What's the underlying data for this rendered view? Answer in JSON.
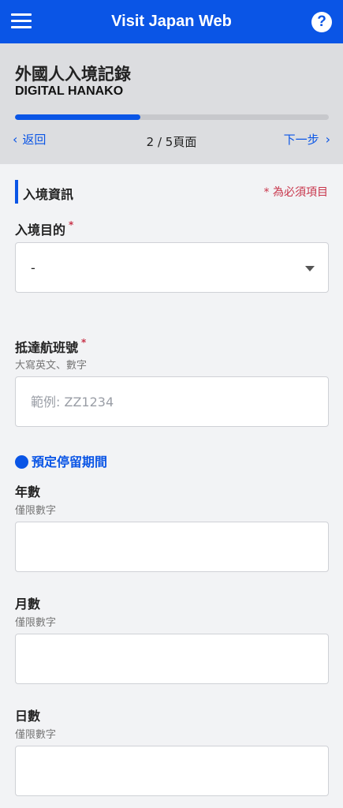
{
  "app": {
    "title": "Visit Japan Web"
  },
  "header": {
    "page_title": "外國人入境記錄",
    "person_name": "DIGITAL HANAKO",
    "progress_fraction": 0.4,
    "back_label": "返回",
    "page_counter": "2 / 5頁面",
    "next_label": "下一步"
  },
  "section": {
    "title": "入境資訊",
    "required_note": "* 為必須項目"
  },
  "purpose": {
    "label": "入境目的",
    "required_mark": "*",
    "selected": "-"
  },
  "flight": {
    "label": "抵達航班號",
    "required_mark": "*",
    "hint": "大寫英文、數字",
    "placeholder": "範例: ZZ1234"
  },
  "stay": {
    "title": "預定停留期間",
    "years": {
      "label": "年數",
      "hint": "僅限數字",
      "value": ""
    },
    "months": {
      "label": "月數",
      "hint": "僅限數字",
      "value": ""
    },
    "days": {
      "label": "日數",
      "hint": "僅限數字",
      "value": ""
    }
  },
  "colors": {
    "brand": "#0a55e6",
    "required": "#c8344a",
    "header_band": "#dcdde0",
    "page_bg": "#f2f3f5"
  },
  "icons": {
    "menu": "hamburger-icon",
    "help": "help-icon",
    "back": "chevron-left-icon",
    "next": "chevron-right-icon",
    "select": "caret-down-icon",
    "section_marker": "dot-icon"
  }
}
